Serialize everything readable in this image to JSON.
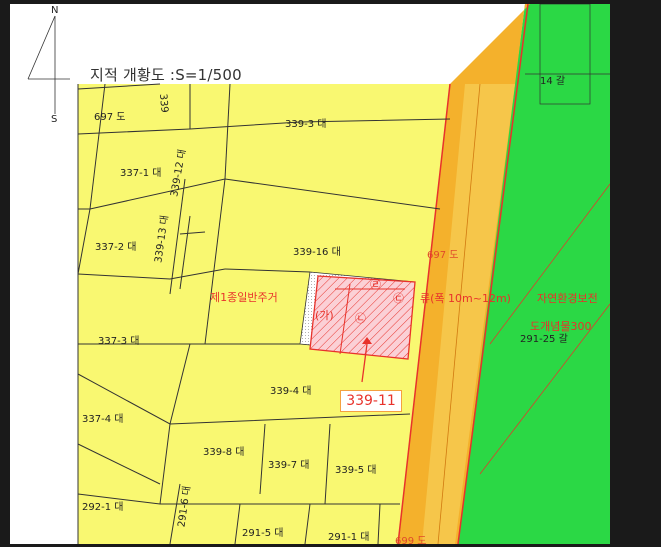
{
  "title": "지적 개황도 :S=1/500",
  "compass": {
    "north": "N",
    "south": "S"
  },
  "parcels": [
    {
      "id": "p697",
      "label": "697 도"
    },
    {
      "id": "p339-top",
      "label": "339"
    },
    {
      "id": "p339-3",
      "label": "339-3 대"
    },
    {
      "id": "p337-1",
      "label": "337-1 대"
    },
    {
      "id": "p339-12",
      "label": "339-12 대"
    },
    {
      "id": "p337-2",
      "label": "337-2 대"
    },
    {
      "id": "p339-13",
      "label": "339-13 대"
    },
    {
      "id": "p339-16",
      "label": "339-16 대"
    },
    {
      "id": "p337-3",
      "label": "337-3 대"
    },
    {
      "id": "p339-4",
      "label": "339-4 대"
    },
    {
      "id": "p337-4",
      "label": "337-4 대"
    },
    {
      "id": "p339-8",
      "label": "339-8 대"
    },
    {
      "id": "p339-7",
      "label": "339-7 대"
    },
    {
      "id": "p339-5",
      "label": "339-5 대"
    },
    {
      "id": "p292-1",
      "label": "292-1 대"
    },
    {
      "id": "p291-6",
      "label": "291-6 대"
    },
    {
      "id": "p291-5",
      "label": "291-5 대"
    },
    {
      "id": "p291-1",
      "label": "291-1 대"
    },
    {
      "id": "p291-25",
      "label": "291-25 갈"
    },
    {
      "id": "p697-road",
      "label": "697 도"
    },
    {
      "id": "p699",
      "label": "699 도"
    },
    {
      "id": "p-top-right",
      "label": "14 갈"
    }
  ],
  "zoning": {
    "residential": "제1종일반주거",
    "road": "류(폭 10m~12m)",
    "natural": "자연환경보전",
    "park": "도개념물300"
  },
  "markers": {
    "ga": "(가)",
    "na": "㉡",
    "da": "㉢",
    "ra": "㉣"
  },
  "callout": "339-11",
  "colors": {
    "parcel_fill": "#f9f871",
    "parcel_line": "#333333",
    "road_fill": "#f4b12c",
    "road_inner": "#f6c64a",
    "green_fill": "#2bd845",
    "zone_red": "#e8322b",
    "hatch_pink": "#f8b8c0"
  }
}
